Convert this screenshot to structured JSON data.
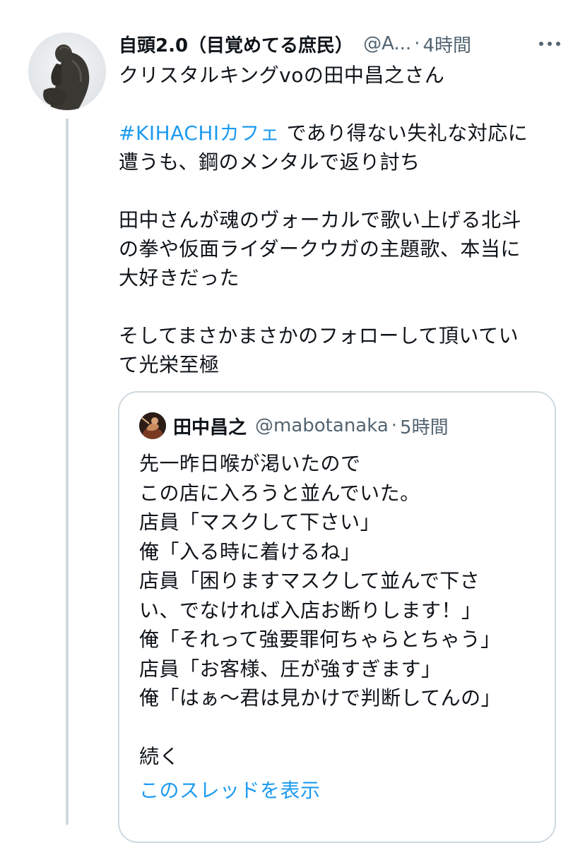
{
  "tweet": {
    "display_name": "自頭2.0（目覚めてる庶民）",
    "handle": "@A...",
    "separator": "·",
    "time": "4時間",
    "more_icon": "more-horizontal-icon",
    "avatar": "thinker-statue-avatar",
    "text_lines": [
      "クリスタルキングvoの田中昌之さん",
      "",
      "",
      "遭うも、鋼のメンタルで返り討ち",
      "",
      "田中さんが魂のヴォーカルで歌い上げる北斗",
      "の拳や仮面ライダークウガの主題歌、本当に",
      "大好きだった",
      "",
      "そしてまさかまさかのフォローして頂いてい",
      "て光栄至極"
    ],
    "hashtag": "#KIHACHIカフェ",
    "hashtag_line_rest": " であり得ない失礼な対応に"
  },
  "quote": {
    "display_name": "田中昌之",
    "handle": "@mabotanaka",
    "separator": "·",
    "time": "5時間",
    "avatar": "performer-photo-avatar",
    "text_lines": [
      "先一昨日喉が渇いたので",
      "この店に入ろうと並んでいた。",
      "店員「マスクして下さい」",
      "俺「入る時に着けるね」",
      "店員「困りますマスクして並んで下さ",
      "い、でなければ入店お断りします！」",
      "俺「それって強要罪何ちゃらとちゃう」",
      "店員「お客様、圧が強すぎます」",
      "俺「はぁ〜君は見かけで判断してんの」",
      "",
      "続く"
    ],
    "show_thread": "このスレッドを表示"
  },
  "colors": {
    "text": "#0f1419",
    "secondary": "#536471",
    "link": "#1d9bf0",
    "border": "#cfd9de"
  }
}
